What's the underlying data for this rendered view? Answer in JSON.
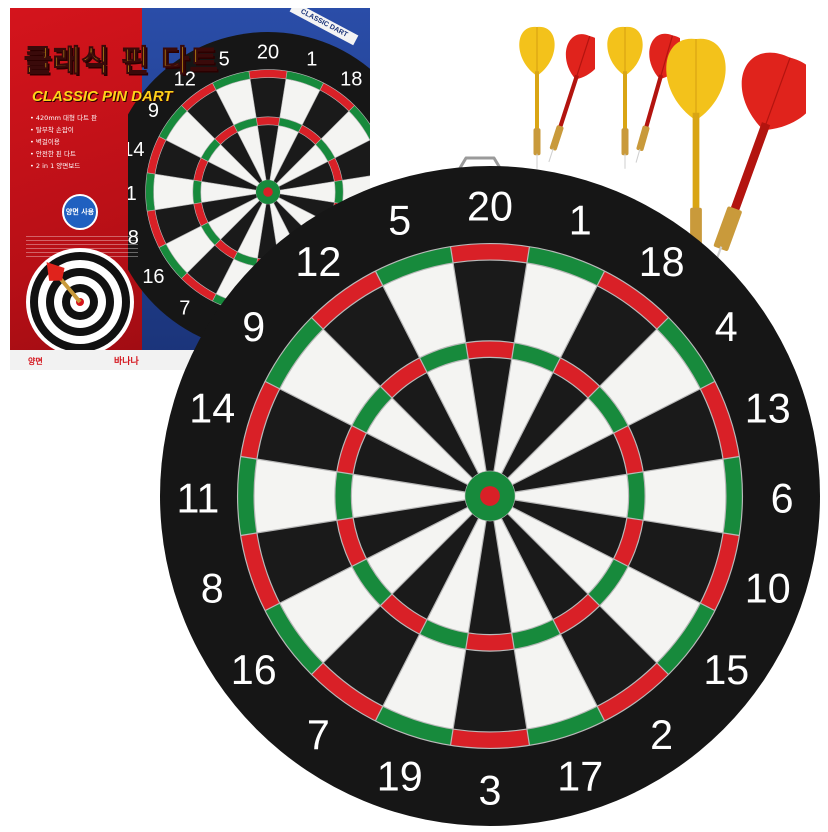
{
  "colors": {
    "board_black": "#161616",
    "segment_black": "#1a1a1a",
    "segment_white": "#f4f4f2",
    "ring_red": "#d92027",
    "ring_green": "#178a3c",
    "wire": "#b9b9b9",
    "box_red": "#d4141c",
    "box_blue": "#1a3378",
    "box_yellow": "#ffd21a",
    "flight_yellow": "#f3c21b",
    "flight_red": "#e0231c",
    "brass": "#c99a3b"
  },
  "board": {
    "numbers": [
      "20",
      "1",
      "18",
      "4",
      "13",
      "6",
      "10",
      "15",
      "2",
      "17",
      "3",
      "19",
      "7",
      "16",
      "8",
      "11",
      "14",
      "9",
      "12",
      "5"
    ]
  },
  "box": {
    "title_kr": "클래식 핀 다트",
    "title_en": "CLASSIC PIN DART",
    "side_tag": "CLASSIC DART",
    "features": [
      "420mm 대형 다트 판",
      "탈부착 손잡이",
      "벽걸이용",
      "안전한 핀 다트",
      "2 in 1 양면보드"
    ],
    "badge": "양면 사용",
    "corner_label": "양면",
    "logo": "바나나"
  }
}
